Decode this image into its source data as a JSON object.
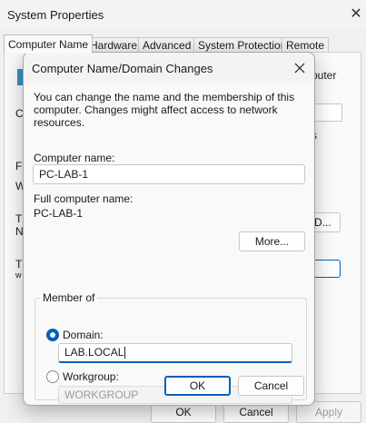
{
  "background_window": {
    "title": "System Properties",
    "tabs": [
      "Computer Name",
      "Hardware",
      "Advanced",
      "System Protection",
      "Remote"
    ],
    "fragments": [
      "puter",
      "C",
      "s",
      "F",
      "W",
      "T",
      "N",
      "D...",
      "T",
      "w"
    ],
    "buttons": {
      "ok": "OK",
      "cancel": "Cancel",
      "apply": "Apply"
    }
  },
  "dialog": {
    "title": "Computer Name/Domain Changes",
    "description": "You can change the name and the membership of this computer. Changes might affect access to network resources.",
    "computer_name_label": "Computer name:",
    "computer_name_value": "PC-LAB-1",
    "full_name_label": "Full computer name:",
    "full_name_value": "PC-LAB-1",
    "more_button": "More...",
    "member_of_label": "Member of",
    "domain_label": "Domain:",
    "domain_value": "LAB.LOCAL",
    "domain_selected": true,
    "workgroup_label": "Workgroup:",
    "workgroup_value": "WORKGROUP",
    "workgroup_selected": false,
    "ok_button": "OK",
    "cancel_button": "Cancel"
  },
  "colors": {
    "accent": "#005fb8",
    "window_bg": "#f9f9f9",
    "disabled_text": "#9a9a9a"
  }
}
